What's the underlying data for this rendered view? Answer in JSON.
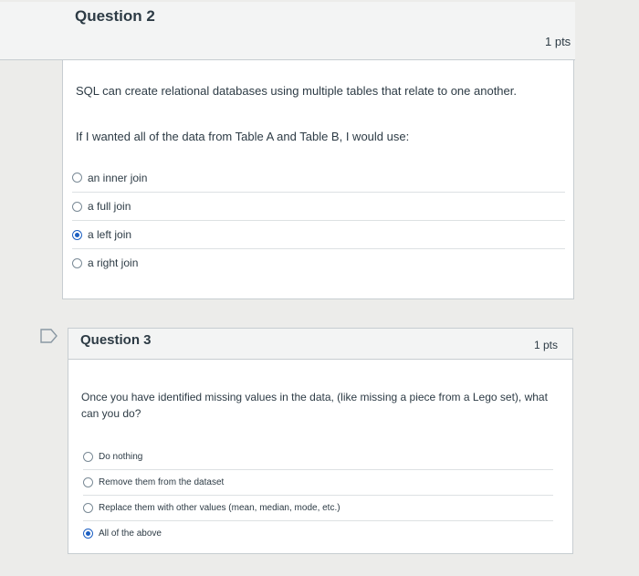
{
  "questions": [
    {
      "title": "Question 2",
      "points": "1 pts",
      "text1": "SQL can create relational databases using multiple tables that relate to one another.",
      "text2": "If I wanted all of the data from Table A and Table B, I would use:",
      "answers": [
        {
          "label": "an inner join",
          "selected": false
        },
        {
          "label": "a full join",
          "selected": false
        },
        {
          "label": "a left join",
          "selected": true
        },
        {
          "label": "a right join",
          "selected": false
        }
      ]
    },
    {
      "title": "Question 3",
      "points": "1 pts",
      "text1": "Once you have identified missing values in the data, (like missing a piece from a Lego set), what can you do?",
      "answers": [
        {
          "label": "Do nothing",
          "selected": false
        },
        {
          "label": "Remove them from the dataset",
          "selected": false
        },
        {
          "label": "Replace them with other values (mean, median, mode, etc.)",
          "selected": false
        },
        {
          "label": "All of the above",
          "selected": true
        }
      ]
    }
  ],
  "colors": {
    "accent": "#1c5fc2",
    "flag": "#e0e4e6"
  }
}
